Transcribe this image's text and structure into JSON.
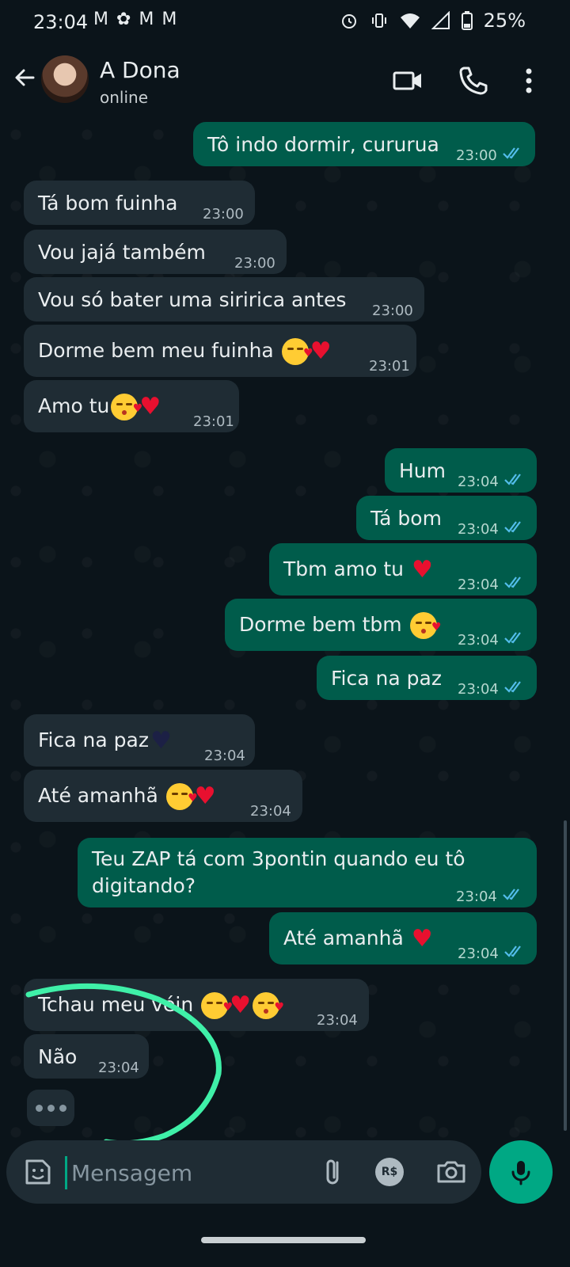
{
  "status_bar": {
    "time": "23:04",
    "battery": "25%"
  },
  "header": {
    "contact_name": "A Dona",
    "contact_status": "online"
  },
  "messages": [
    {
      "dir": "out",
      "text": "Tô indo dormir, cururua",
      "time": "23:00"
    },
    {
      "dir": "in",
      "text": "Tá bom fuinha",
      "time": "23:00"
    },
    {
      "dir": "in",
      "text": "Vou jajá também",
      "time": "23:00"
    },
    {
      "dir": "in",
      "text": "Vou só bater uma siririca antes",
      "time": "23:00"
    },
    {
      "dir": "in",
      "text": "Dorme bem meu fuinha",
      "emoji": [
        "smiling-face-with-hearts",
        "red-heart"
      ],
      "time": "23:01"
    },
    {
      "dir": "in",
      "text": "Amo tu",
      "emoji": [
        "face-blowing-kiss",
        "red-heart"
      ],
      "time": "23:01"
    },
    {
      "dir": "out",
      "text": "Hum",
      "time": "23:04"
    },
    {
      "dir": "out",
      "text": "Tá bom",
      "time": "23:04"
    },
    {
      "dir": "out",
      "text": "Tbm amo tu",
      "emoji": [
        "red-heart"
      ],
      "time": "23:04"
    },
    {
      "dir": "out",
      "text": "Dorme bem tbm",
      "emoji": [
        "face-blowing-kiss"
      ],
      "time": "23:04"
    },
    {
      "dir": "out",
      "text": "Fica na paz",
      "time": "23:04"
    },
    {
      "dir": "in",
      "text": "Fica na paz",
      "emoji": [
        "black-heart"
      ],
      "time": "23:04"
    },
    {
      "dir": "in",
      "text": "Até amanhã",
      "emoji": [
        "smiling-face-with-hearts",
        "red-heart"
      ],
      "time": "23:04"
    },
    {
      "dir": "out",
      "text_line1": "Teu ZAP tá com 3pontin quando eu tô",
      "text_line2": "digitando?",
      "time": "23:04"
    },
    {
      "dir": "out",
      "text": "Até amanhã",
      "emoji": [
        "red-heart"
      ],
      "time": "23:04"
    },
    {
      "dir": "in",
      "text": "Tchau meu véin",
      "emoji": [
        "smiling-face-with-hearts",
        "red-heart",
        "face-blowing-kiss"
      ],
      "time": "23:04"
    },
    {
      "dir": "in",
      "text": "Não",
      "time": "23:04"
    }
  ],
  "composer": {
    "placeholder": "Mensagem",
    "pay_label": "R$"
  },
  "colors": {
    "background": "#0b141a",
    "incoming_bubble": "#1f2c34",
    "outgoing_bubble": "#005c4b",
    "accent": "#00a884",
    "read_ticks": "#53bdeb",
    "annotation_stroke": "#3ff0a8"
  },
  "icons": [
    "back-arrow-icon",
    "video-call-icon",
    "voice-call-icon",
    "more-options-icon",
    "sticker-icon",
    "attach-clip-icon",
    "payment-icon",
    "camera-icon",
    "mic-icon"
  ]
}
